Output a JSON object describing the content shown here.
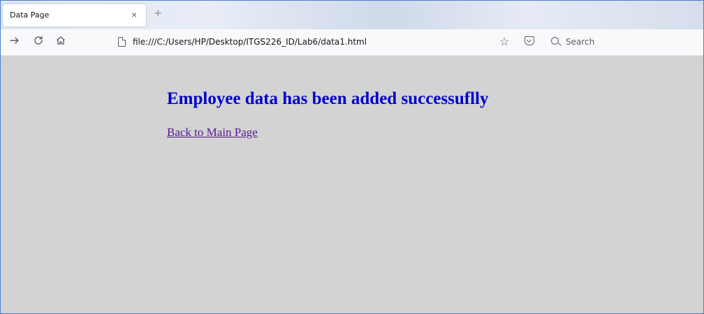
{
  "browser": {
    "tab": {
      "title": "Data Page",
      "close_glyph": "×"
    },
    "new_tab_glyph": "+",
    "nav": {
      "forward_icon": "arrow-right-icon",
      "reload_icon": "reload-icon",
      "home_icon": "home-icon"
    },
    "address": {
      "url": "file:///C:/Users/HP/Desktop/ITGS226_ID/Lab6/data1.html",
      "page_icon": "page-icon",
      "bookmark_icon": "star-icon",
      "pocket_icon": "pocket-icon"
    },
    "search": {
      "placeholder": "Search"
    }
  },
  "page": {
    "background": "#d3d3d3",
    "heading": "Employee data has been added successuflly",
    "heading_color": "#0000cd",
    "link_text": "Back to Main Page",
    "link_color": "#551a8b"
  }
}
